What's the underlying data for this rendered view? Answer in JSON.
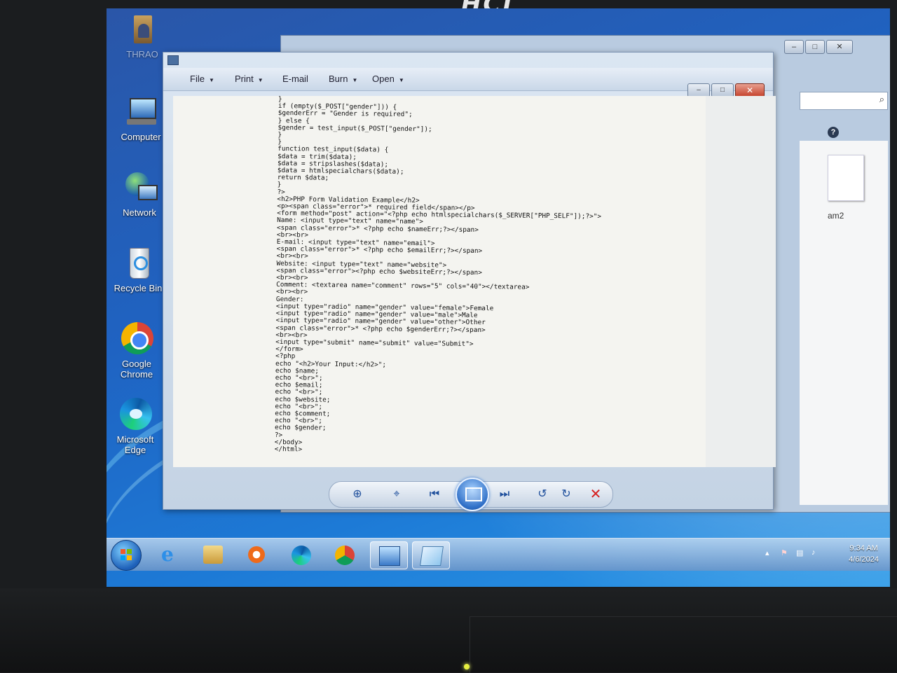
{
  "monitor": {
    "brand": "HCL"
  },
  "desktop": {
    "icons": [
      {
        "label": "THRAO"
      },
      {
        "label": "Computer"
      },
      {
        "label": "Network"
      },
      {
        "label": "Recycle Bin"
      },
      {
        "label_line1": "Google",
        "label_line2": "Chrome"
      },
      {
        "label_line1": "Microsoft",
        "label_line2": "Edge"
      }
    ]
  },
  "background_window": {
    "filename_fragment": "am2"
  },
  "viewer": {
    "menu": {
      "file": "File",
      "print": "Print",
      "email": "E-mail",
      "burn": "Burn",
      "open": "Open"
    },
    "code_lines": [
      "}",
      "if (empty($_POST[\"gender\"])) {",
      "$genderErr = \"Gender is required\";",
      "} else {",
      "$gender = test_input($_POST[\"gender\"]);",
      "}",
      "}",
      "function test_input($data) {",
      "$data = trim($data);",
      "$data = stripslashes($data);",
      "$data = htmlspecialchars($data);",
      "return $data;",
      "}",
      "?>",
      "<h2>PHP Form Validation Example</h2>",
      "<p><span class=\"error\">* required field</span></p>",
      "<form method=\"post\" action=\"<?php echo htmlspecialchars($_SERVER[\"PHP_SELF\"]);?>\">",
      "Name: <input type=\"text\" name=\"name\">",
      "<span class=\"error\">* <?php echo $nameErr;?></span>",
      "<br><br>",
      "E-mail: <input type=\"text\" name=\"email\">",
      "<span class=\"error\">* <?php echo $emailErr;?></span>",
      "<br><br>",
      "Website: <input type=\"text\" name=\"website\">",
      "<span class=\"error\"><?php echo $websiteErr;?></span>",
      "<br><br>",
      "Comment: <textarea name=\"comment\" rows=\"5\" cols=\"40\"></textarea>",
      "<br><br>",
      "Gender:",
      "<input type=\"radio\" name=\"gender\" value=\"female\">Female",
      "<input type=\"radio\" name=\"gender\" value=\"male\">Male",
      "<input type=\"radio\" name=\"gender\" value=\"other\">Other",
      "<span class=\"error\">* <?php echo $genderErr;?></span>",
      "<br><br>",
      "<input type=\"submit\" name=\"submit\" value=\"Submit\">",
      "</form>",
      "<?php",
      "echo \"<h2>Your Input:</h2>\";",
      "echo $name;",
      "echo \"<br>\";",
      "echo $email;",
      "echo \"<br>\";",
      "echo $website;",
      "echo \"<br>\";",
      "echo $comment;",
      "echo \"<br>\";",
      "echo $gender;",
      "?>",
      "</body>",
      "</html>"
    ]
  },
  "taskbar": {
    "clock_time": "9:34 AM",
    "clock_date": "4/6/2024"
  },
  "colors": {
    "desktop_blue": "#1f63c2",
    "close_red": "#c4402a",
    "viewer_control_blue": "#1f4f9c"
  }
}
